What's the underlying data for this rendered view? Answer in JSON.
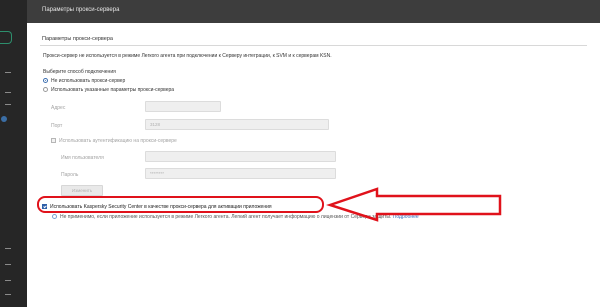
{
  "dialog": {
    "title": "Параметры прокси-сервера"
  },
  "section": {
    "title": "Параметры прокси-сервера",
    "description": "Прокси-сервер не используется в режиме Легкого агента при подключении к Серверу интеграции, к SVM и к серверам KSN."
  },
  "connection": {
    "label": "Выберите способ подключения",
    "options": [
      {
        "label": "Не использовать прокси-сервер",
        "checked": true
      },
      {
        "label": "Использовать указанные параметры прокси-сервера",
        "checked": false
      }
    ]
  },
  "proxy": {
    "address_label": "Адрес",
    "address_value": "",
    "port_label": "Порт",
    "port_value": "3128",
    "auth_checkbox_label": "Использовать аутентификацию на прокси-сервере",
    "username_label": "Имя пользователя",
    "username_value": "",
    "password_label": "Пароль",
    "password_value": "********",
    "change_button": "Изменить"
  },
  "ksc_proxy": {
    "label": "Использовать Kaspersky Security Center в качестве прокси-сервера для активации приложения",
    "checked": true
  },
  "note": {
    "text": "Не применимо, если приложение используется в режиме Легкого агента. Легкий агент получает информацию о лицензии от Сервера защиты.",
    "link": "Подробнее"
  },
  "colors": {
    "header": "#3d3d3d",
    "accent": "#2f5fa8",
    "annotation": "#e0121b",
    "link": "#2f6fc1"
  }
}
